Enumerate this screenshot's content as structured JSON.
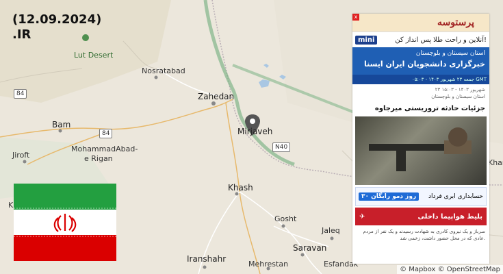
{
  "title": {
    "line1": "(12.09.2024)",
    "line2": ".IR"
  },
  "places": {
    "lut_desert": "Lut Desert",
    "nosratabad": "Nosratabad",
    "zahedan": "Zahedan",
    "mirjaveh": "Mirjaveh",
    "bam": "Bam",
    "mohammadabad": "MohammadAbad-",
    "mohammadabad2": "e Rigan",
    "jiroft": "Jiroft",
    "khash": "Khash",
    "gosht": "Gosht",
    "saravan": "Saravan",
    "jaleq": "Jaleq",
    "iranshahr": "Iranshahr",
    "mehrestan": "Mehrestan",
    "esfandak": "Esfandak",
    "khar": "Khar",
    "k": "K"
  },
  "roads": {
    "r84a": "84",
    "r84b": "84",
    "n40": "N40"
  },
  "attribution": "© Mapbox © OpenStreetMap",
  "flag": {
    "green": "#239f40",
    "white": "#ffffff",
    "red": "#da0000",
    "emblem": "#da0000",
    "emblem_icon": "iran-emblem"
  },
  "marker": {
    "color": "#555555",
    "icon": "map-pin"
  },
  "news": {
    "site_name": "پرستوسه",
    "ad1_brand": "mini",
    "ad1_text": "آنلاین و راحت طلا پس انداز کن!",
    "province": "استان سیستان و بلوچستان",
    "agency": "خبرگزاری دانشجویان ایران ایسنا",
    "date_bar": "جمعه ۲۳ شهریور ۱۴۰۳ - ۰۵:۰۳ GMT",
    "meta1": "۲۳ شهریور ۱۴۰۳ - ۱۵:۰۳",
    "meta2": "استان سیستان و بلوچستان",
    "headline": "جزئیات حادثه تروریستی میرجاوه",
    "ad2_text": "حسابداری ابری فرداد",
    "ad2_badge": "۳۰ روز دمو رایگان",
    "ad3_text": "بلیط هواپیما داخلی",
    "body_text": "سرباز و یک نیروی کادری به شهادت رسیدند و یک نفر از مردم عادی که در محل حضور داشت، زخمی شد.",
    "close_label": "x"
  }
}
